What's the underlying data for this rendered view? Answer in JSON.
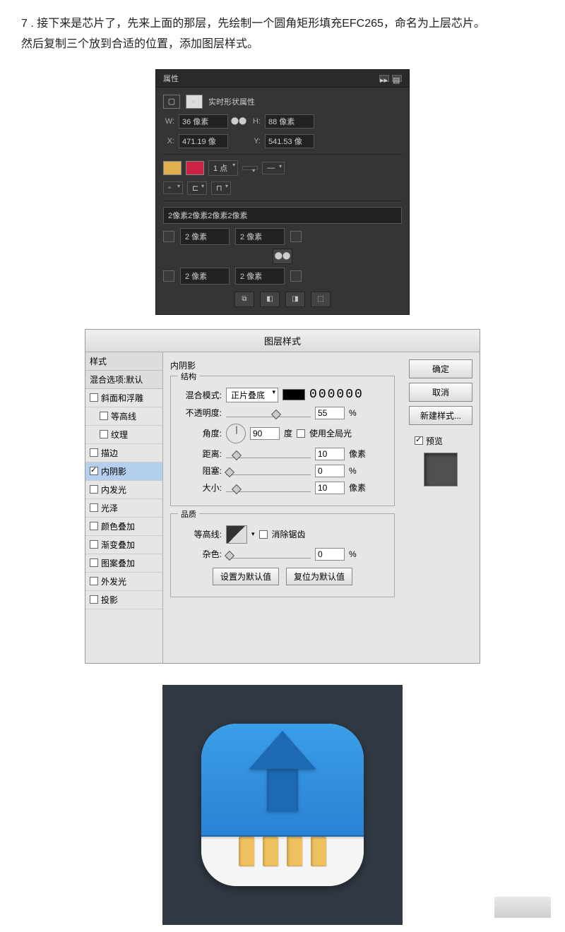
{
  "step": {
    "number": "7",
    "text1": "7 . 接下来是芯片了，先来上面的那层，先绘制一个圆角矩形填充EFC265，命名为上层芯片。",
    "text2": "然后复制三个放到合适的位置，添加图层样式。"
  },
  "propsPanel": {
    "title": "属性",
    "subtitle": "实时形状属性",
    "w_label": "W:",
    "w_value": "36 像素",
    "h_label": "H:",
    "h_value": "88 像素",
    "x_label": "X:",
    "x_value": "471.19 像",
    "y_label": "Y:",
    "y_value": "541.53 像",
    "stroke": "1 点",
    "radius_header": "2像素2像素2像素2像素",
    "r1": "2 像素",
    "r2": "2 像素",
    "r3": "2 像素",
    "r4": "2 像素",
    "link": "⬤⬤"
  },
  "layerStyle": {
    "title": "图层样式",
    "sidebar": {
      "header1": "样式",
      "header2": "混合选项:默认",
      "items": [
        {
          "label": "斜面和浮雕",
          "checked": false,
          "indent": false
        },
        {
          "label": "等高线",
          "checked": false,
          "indent": true
        },
        {
          "label": "纹理",
          "checked": false,
          "indent": true
        },
        {
          "label": "描边",
          "checked": false,
          "indent": false
        },
        {
          "label": "内阴影",
          "checked": true,
          "indent": false,
          "selected": true
        },
        {
          "label": "内发光",
          "checked": false,
          "indent": false
        },
        {
          "label": "光泽",
          "checked": false,
          "indent": false
        },
        {
          "label": "颜色叠加",
          "checked": false,
          "indent": false
        },
        {
          "label": "渐变叠加",
          "checked": false,
          "indent": false
        },
        {
          "label": "图案叠加",
          "checked": false,
          "indent": false
        },
        {
          "label": "外发光",
          "checked": false,
          "indent": false
        },
        {
          "label": "投影",
          "checked": false,
          "indent": false
        }
      ]
    },
    "buttons": {
      "ok": "确定",
      "cancel": "取消",
      "newStyle": "新建样式...",
      "preview": "预览"
    },
    "section": {
      "title": "内阴影",
      "group1": "结构",
      "blendMode_l": "混合模式:",
      "blendMode_v": "正片叠底",
      "hex": "000000",
      "opacity_l": "不透明度:",
      "opacity_v": "55",
      "pct": "%",
      "angle_l": "角度:",
      "angle_v": "90",
      "deg": "度",
      "global": "使用全局光",
      "distance_l": "距离:",
      "distance_v": "10",
      "px": "像素",
      "choke_l": "阻塞:",
      "choke_v": "0",
      "size_l": "大小:",
      "size_v": "10",
      "group2": "品质",
      "contour_l": "等高线:",
      "aa": "消除锯齿",
      "noise_l": "杂色:",
      "noise_v": "0",
      "reset1": "设置为默认值",
      "reset2": "复位为默认值"
    }
  }
}
